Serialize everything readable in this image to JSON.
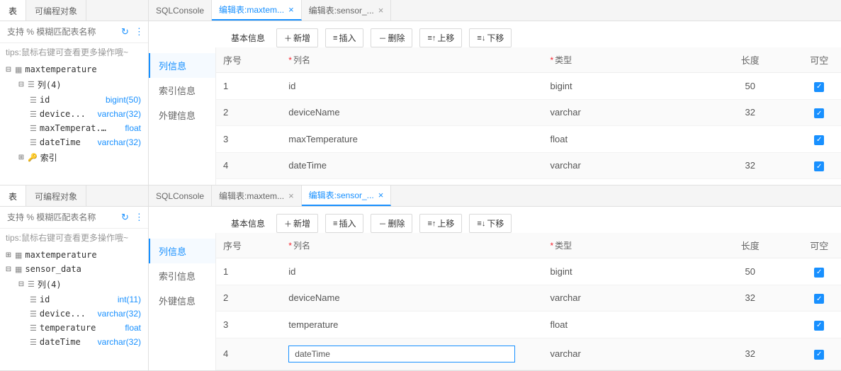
{
  "common": {
    "side_tabs": {
      "table": "表",
      "prog_obj": "可编程对象"
    },
    "search_placeholder": "支持 % 模糊匹配表名称",
    "tips": "tips:鼠标右键可查看更多操作哦~",
    "left_nav": {
      "basic": "基本信息",
      "columns": "列信息",
      "indexes": "索引信息",
      "fks": "外键信息"
    },
    "toolbar": {
      "add": "新增",
      "insert": "插入",
      "delete": "删除",
      "move_up": "上移",
      "move_down": "下移",
      "add_icon": "＋",
      "insert_icon": "≡",
      "delete_icon": "－",
      "up_icon": "≡↑",
      "down_icon": "≡↓"
    },
    "headers": {
      "seq": "序号",
      "name": "列名",
      "type": "类型",
      "length": "长度",
      "nullable": "可空"
    }
  },
  "top": {
    "tree": {
      "tables": [
        {
          "name": "maxtemperature",
          "col_count": "列(4)",
          "index_label": "索引",
          "columns": [
            {
              "name": "id",
              "type": "bigint(50)"
            },
            {
              "name": "device...",
              "type": "varchar(32)"
            },
            {
              "name": "maxTemperat...",
              "type": "float"
            },
            {
              "name": "dateTime",
              "type": "varchar(32)"
            }
          ]
        }
      ]
    },
    "main_tabs": [
      {
        "label": "SQLConsole",
        "closable": false,
        "active": false
      },
      {
        "label": "编辑表:maxtem...",
        "closable": true,
        "active": true
      },
      {
        "label": "编辑表:sensor_...",
        "closable": true,
        "active": false
      }
    ],
    "rows": [
      {
        "seq": "1",
        "name": "id",
        "type": "bigint",
        "length": "50",
        "nullable": true
      },
      {
        "seq": "2",
        "name": "deviceName",
        "type": "varchar",
        "length": "32",
        "nullable": true
      },
      {
        "seq": "3",
        "name": "maxTemperature",
        "type": "float",
        "length": "",
        "nullable": true
      },
      {
        "seq": "4",
        "name": "dateTime",
        "type": "varchar",
        "length": "32",
        "nullable": true
      }
    ]
  },
  "bottom": {
    "tree": {
      "tables": [
        {
          "name": "maxtemperature",
          "expanded": false
        },
        {
          "name": "sensor_data",
          "expanded": true,
          "col_count": "列(4)",
          "columns": [
            {
              "name": "id",
              "type": "int(11)"
            },
            {
              "name": "device...",
              "type": "varchar(32)"
            },
            {
              "name": "temperature",
              "type": "float"
            },
            {
              "name": "dateTime",
              "type": "varchar(32)"
            }
          ]
        }
      ]
    },
    "main_tabs": [
      {
        "label": "SQLConsole",
        "closable": false,
        "active": false
      },
      {
        "label": "编辑表:maxtem...",
        "closable": true,
        "active": false
      },
      {
        "label": "编辑表:sensor_...",
        "closable": true,
        "active": true
      }
    ],
    "rows": [
      {
        "seq": "1",
        "name": "id",
        "type": "bigint",
        "length": "50",
        "nullable": true,
        "editing": false
      },
      {
        "seq": "2",
        "name": "deviceName",
        "type": "varchar",
        "length": "32",
        "nullable": true,
        "editing": false
      },
      {
        "seq": "3",
        "name": "temperature",
        "type": "float",
        "length": "",
        "nullable": true,
        "editing": false
      },
      {
        "seq": "4",
        "name": "dateTime",
        "type": "varchar",
        "length": "32",
        "nullable": true,
        "editing": true
      }
    ]
  }
}
